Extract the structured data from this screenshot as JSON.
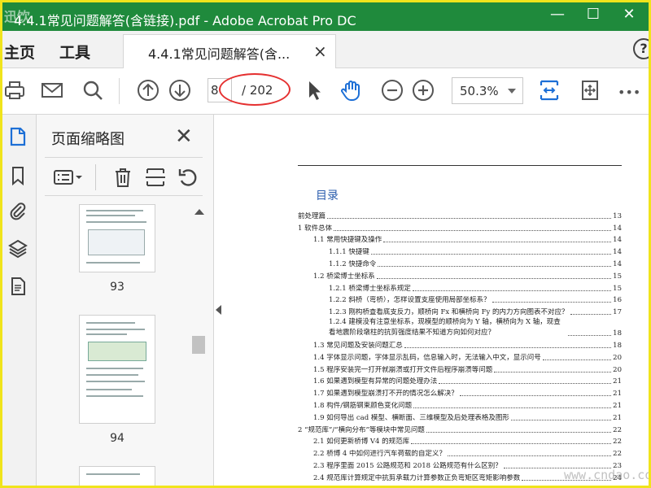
{
  "window": {
    "title": "4.4.1常见问题解答(含链接).pdf - Adobe Acrobat Pro DC",
    "watermark_top": "迅饮",
    "minimize": "—",
    "maximize": "☐",
    "close": "✕"
  },
  "tabs": {
    "home": "主页",
    "tools": "工具",
    "document": "4.4.1常见问题解答(含...",
    "close": "×",
    "help": "?"
  },
  "toolbar": {
    "page_value": "8",
    "page_total": "/ 202",
    "zoom": "50.3%",
    "more": "•••"
  },
  "thumbnail_panel": {
    "title": "页面缩略图",
    "close": "✕",
    "pages": [
      "93",
      "94"
    ]
  },
  "toc": {
    "title": "目录",
    "entries": [
      {
        "level": 1,
        "text": "前处理篇",
        "page": "13"
      },
      {
        "level": 1,
        "text": "1 软件总体",
        "page": "14"
      },
      {
        "level": 2,
        "text": "1.1 常用快捷键及操作",
        "page": "14"
      },
      {
        "level": 3,
        "text": "1.1.1 快捷键",
        "page": "14"
      },
      {
        "level": 3,
        "text": "1.1.2 快捷命令",
        "page": "14"
      },
      {
        "level": 2,
        "text": "1.2 桥梁博士坐标系",
        "page": "15"
      },
      {
        "level": 3,
        "text": "1.2.1 桥梁博士坐标系规定",
        "page": "15"
      },
      {
        "level": 3,
        "text": "1.2.2 斜桥（弯桥），怎样设置支座使用局部坐标系？",
        "page": "16"
      },
      {
        "level": 3,
        "text": "1.2.3 刚构桥査看底支反力，顺桥向 Fx 和横桥向 Fy 的内力方向图表不对应？",
        "page": "17"
      },
      {
        "level": 3,
        "text": "1.2.4 建模没有注意坐标系，现模型的顺桥向为 Y 轴，横桥向为 X 轴，现查看地震阶段墩柱的抗剪强度结果不知道方向如何对应？",
        "page": "18",
        "tall": true
      },
      {
        "level": 2,
        "text": "1.3 常见问题及安装问题汇总",
        "page": "18"
      },
      {
        "level": 2,
        "text": "1.4 字体显示问题，字体显示乱码，信息输入时，无法输入中文，显示问号",
        "page": "20"
      },
      {
        "level": 2,
        "text": "1.5 程序安装完一打开就崩溃或打开文件后程序崩溃等问题",
        "page": "20"
      },
      {
        "level": 2,
        "text": "1.6 如果遇到模型有异常的问题处理办法",
        "page": "21"
      },
      {
        "level": 2,
        "text": "1.7 如果遇到模型崩溃打不开的情况怎么解决？",
        "page": "21"
      },
      {
        "level": 2,
        "text": "1.8 构件/钢筋钢束颜色变化问题",
        "page": "21"
      },
      {
        "level": 2,
        "text": "1.9 如何导出 cad 模型、横断面、三维模型及后处理表格及图形",
        "page": "21"
      },
      {
        "level": 1,
        "text": "2 “规范库”/“横向分布”等模块中常见问题",
        "page": "22"
      },
      {
        "level": 2,
        "text": "2.1 如何更新桥博 V4 的规范库",
        "page": "22"
      },
      {
        "level": 2,
        "text": "2.2 桥博 4 中如何进行汽车荷载的自定义？",
        "page": "22"
      },
      {
        "level": 2,
        "text": "2.3 程序里面 2015 公路规范和 2018 公路规范有什么区别？",
        "page": "23"
      },
      {
        "level": 2,
        "text": "2.4 规范库计算规定中抗剪承载力计算参数正负弯矩区弯矩影响参数",
        "page": "24"
      }
    ]
  },
  "site_watermark": "www.cndao.com"
}
